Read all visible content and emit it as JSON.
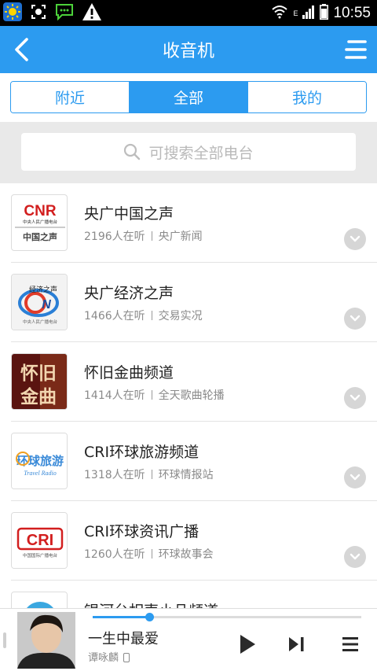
{
  "status_bar": {
    "time": "10:55",
    "signal_label": "E"
  },
  "header": {
    "title": "收音机"
  },
  "tabs": [
    {
      "label": "附近",
      "active": false
    },
    {
      "label": "全部",
      "active": true
    },
    {
      "label": "我的",
      "active": false
    }
  ],
  "search": {
    "placeholder": "可搜索全部电台"
  },
  "stations": [
    {
      "name": "央广中国之声",
      "listeners": "2196人在听",
      "program": "央广新闻",
      "logo": "cnr-logo"
    },
    {
      "name": "央广经济之声",
      "listeners": "1466人在听",
      "program": "交易实况",
      "logo": "cnr-economy-logo"
    },
    {
      "name": "怀旧金曲频道",
      "listeners": "1414人在听",
      "program": "全天歌曲轮播",
      "logo": "golden-oldies-logo"
    },
    {
      "name": "CRI环球旅游频道",
      "listeners": "1318人在听",
      "program": "环球情报站",
      "logo": "cri-travel-logo"
    },
    {
      "name": "CRI环球资讯广播",
      "listeners": "1260人在听",
      "program": "环球故事会",
      "logo": "cri-news-logo"
    },
    {
      "name": "银河台相声小品频道",
      "listeners": "",
      "program": "",
      "logo": "galaxy-logo"
    }
  ],
  "logos": {
    "cnr_text": "CNR",
    "cnr_sub": "中央人民广播电台",
    "cnr_name": "中国之声",
    "economy_text": "经济之声",
    "economy_sub": "中央人民广播电台",
    "oldies_top": "怀旧",
    "oldies_bottom": "金曲",
    "travel_chars": "环球旅游",
    "travel_en": "Travel Radio",
    "cri_text": "CRI",
    "cri_sub": "中国国际广播电台"
  },
  "player": {
    "title": "一生中最爱",
    "artist": "谭咏麟",
    "progress": 0.21
  },
  "colors": {
    "accent": "#2c9bf0",
    "status_bar": "#000000",
    "search_bg": "#e9e9e9"
  }
}
